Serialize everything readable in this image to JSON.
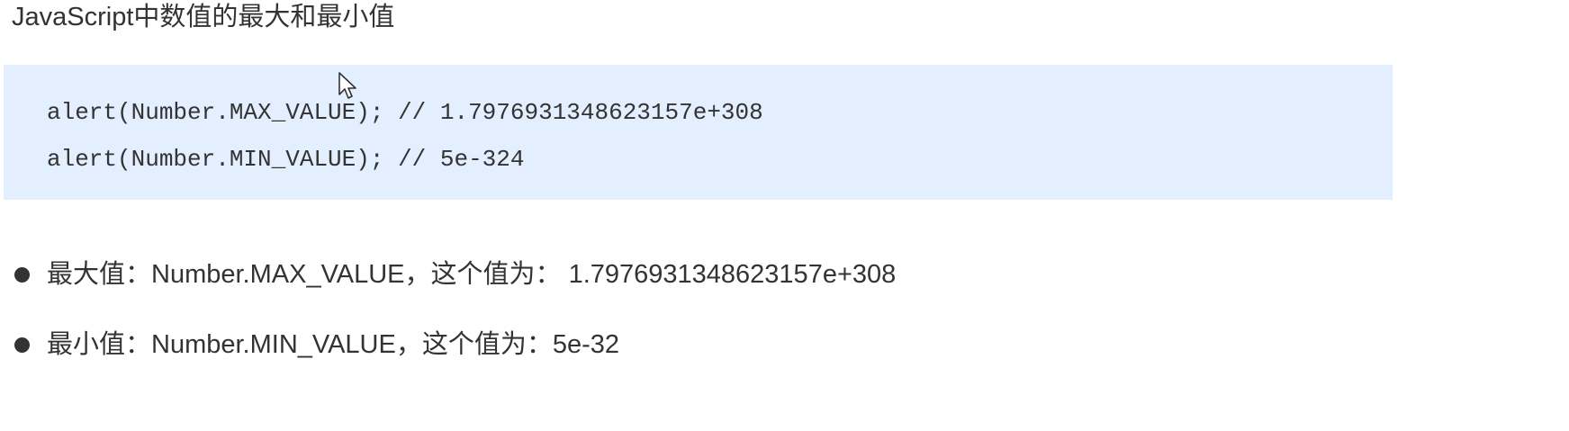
{
  "heading": "JavaScript中数值的最大和最小值",
  "code": {
    "lines": [
      "alert(Number.MAX_VALUE); // 1.7976931348623157e+308",
      "alert(Number.MIN_VALUE); // 5e-324"
    ]
  },
  "bullets": [
    {
      "text": "最大值：Number.MAX_VALUE，这个值为： 1.7976931348623157e+308"
    },
    {
      "text": "最小值：Number.MIN_VALUE，这个值为：5e-32"
    }
  ],
  "icons": {
    "cursor": "mouse-pointer-icon",
    "bullet": "bullet-dot-icon"
  },
  "colors": {
    "code_background": "#e3eefe",
    "text": "#333333"
  }
}
